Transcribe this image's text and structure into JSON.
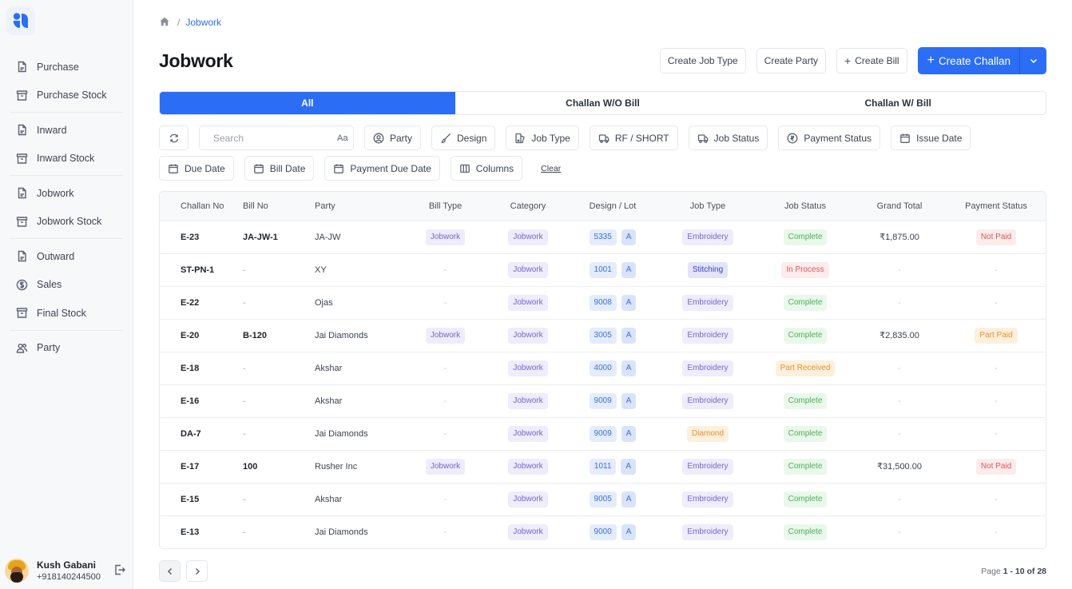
{
  "app": {
    "brand_color": "#2b6ef5"
  },
  "sidebar": {
    "items": [
      {
        "label": "Purchase",
        "icon": "document-icon"
      },
      {
        "label": "Purchase Stock",
        "icon": "archive-icon"
      },
      {
        "label": "Inward",
        "icon": "document-icon"
      },
      {
        "label": "Inward Stock",
        "icon": "archive-icon"
      },
      {
        "label": "Jobwork",
        "icon": "document-icon"
      },
      {
        "label": "Jobwork Stock",
        "icon": "archive-icon"
      },
      {
        "label": "Outward",
        "icon": "document-icon"
      },
      {
        "label": "Sales",
        "icon": "dollar-circle-icon"
      },
      {
        "label": "Final Stock",
        "icon": "archive-icon"
      },
      {
        "label": "Party",
        "icon": "users-icon"
      }
    ],
    "user": {
      "name": "Kush Gabani",
      "phone": "+918140244500"
    }
  },
  "breadcrumb": {
    "current": "Jobwork"
  },
  "header": {
    "title": "Jobwork",
    "actions": {
      "create_job_type": "Create Job Type",
      "create_party": "Create Party",
      "create_bill": "Create Bill",
      "create_challan": "Create Challan"
    }
  },
  "tabs": [
    {
      "label": "All",
      "active": true
    },
    {
      "label": "Challan W/O Bill",
      "active": false
    },
    {
      "label": "Challan W/ Bill",
      "active": false
    }
  ],
  "filters": {
    "search_placeholder": "Search",
    "search_value": "",
    "case_toggle": "Aa",
    "party": "Party",
    "design": "Design",
    "job_type": "Job Type",
    "rf_short": "RF / SHORT",
    "job_status": "Job Status",
    "payment_status": "Payment Status",
    "issue_date": "Issue Date",
    "due_date": "Due Date",
    "bill_date": "Bill Date",
    "payment_due_date": "Payment Due Date",
    "columns": "Columns",
    "clear": "Clear"
  },
  "table": {
    "columns": [
      "Challan No",
      "Bill No",
      "Party",
      "Bill Type",
      "Category",
      "Design / Lot",
      "Job Type",
      "Job Status",
      "Grand Total",
      "Payment Status"
    ],
    "rows": [
      {
        "challan_no": "E-23",
        "bill_no": "JA-JW-1",
        "party": "JA-JW",
        "bill_type": "Jobwork",
        "category": "Jobwork",
        "design": "5335",
        "lot": "A",
        "job_type": "Embroidery",
        "job_type_color": "purple",
        "job_status": "Complete",
        "job_status_color": "green",
        "grand_total": "₹1,875.00",
        "payment_status": "Not Paid",
        "payment_color": "red"
      },
      {
        "challan_no": "ST-PN-1",
        "bill_no": "-",
        "party": "XY",
        "bill_type": "-",
        "category": "Jobwork",
        "design": "1001",
        "lot": "A",
        "job_type": "Stitching",
        "job_type_color": "indigo",
        "job_status": "In Process",
        "job_status_color": "red",
        "grand_total": "-",
        "payment_status": "-",
        "payment_color": ""
      },
      {
        "challan_no": "E-22",
        "bill_no": "-",
        "party": "Ojas",
        "bill_type": "-",
        "category": "Jobwork",
        "design": "9008",
        "lot": "A",
        "job_type": "Embroidery",
        "job_type_color": "purple",
        "job_status": "Complete",
        "job_status_color": "green",
        "grand_total": "-",
        "payment_status": "-",
        "payment_color": ""
      },
      {
        "challan_no": "E-20",
        "bill_no": "B-120",
        "party": "Jai Diamonds",
        "bill_type": "Jobwork",
        "category": "Jobwork",
        "design": "3005",
        "lot": "A",
        "job_type": "Embroidery",
        "job_type_color": "purple",
        "job_status": "Complete",
        "job_status_color": "green",
        "grand_total": "₹2,835.00",
        "payment_status": "Part Paid",
        "payment_color": "orange"
      },
      {
        "challan_no": "E-18",
        "bill_no": "-",
        "party": "Akshar",
        "bill_type": "-",
        "category": "Jobwork",
        "design": "4000",
        "lot": "A",
        "job_type": "Embroidery",
        "job_type_color": "purple",
        "job_status": "Part Received",
        "job_status_color": "orange",
        "grand_total": "-",
        "payment_status": "-",
        "payment_color": ""
      },
      {
        "challan_no": "E-16",
        "bill_no": "-",
        "party": "Akshar",
        "bill_type": "-",
        "category": "Jobwork",
        "design": "9009",
        "lot": "A",
        "job_type": "Embroidery",
        "job_type_color": "purple",
        "job_status": "Complete",
        "job_status_color": "green",
        "grand_total": "-",
        "payment_status": "-",
        "payment_color": ""
      },
      {
        "challan_no": "DA-7",
        "bill_no": "-",
        "party": "Jai Diamonds",
        "bill_type": "-",
        "category": "Jobwork",
        "design": "9009",
        "lot": "A",
        "job_type": "Diamond",
        "job_type_color": "orange",
        "job_status": "Complete",
        "job_status_color": "green",
        "grand_total": "-",
        "payment_status": "-",
        "payment_color": ""
      },
      {
        "challan_no": "E-17",
        "bill_no": "100",
        "party": "Rusher Inc",
        "bill_type": "Jobwork",
        "category": "Jobwork",
        "design": "1011",
        "lot": "A",
        "job_type": "Embroidery",
        "job_type_color": "purple",
        "job_status": "Complete",
        "job_status_color": "green",
        "grand_total": "₹31,500.00",
        "payment_status": "Not Paid",
        "payment_color": "red"
      },
      {
        "challan_no": "E-15",
        "bill_no": "-",
        "party": "Akshar",
        "bill_type": "-",
        "category": "Jobwork",
        "design": "9005",
        "lot": "A",
        "job_type": "Embroidery",
        "job_type_color": "purple",
        "job_status": "Complete",
        "job_status_color": "green",
        "grand_total": "-",
        "payment_status": "-",
        "payment_color": ""
      },
      {
        "challan_no": "E-13",
        "bill_no": "-",
        "party": "Jai Diamonds",
        "bill_type": "-",
        "category": "Jobwork",
        "design": "9000",
        "lot": "A",
        "job_type": "Embroidery",
        "job_type_color": "purple",
        "job_status": "Complete",
        "job_status_color": "green",
        "grand_total": "-",
        "payment_status": "-",
        "payment_color": ""
      }
    ]
  },
  "pagination": {
    "prefix": "Page",
    "range": "1 - 10 of 28"
  }
}
